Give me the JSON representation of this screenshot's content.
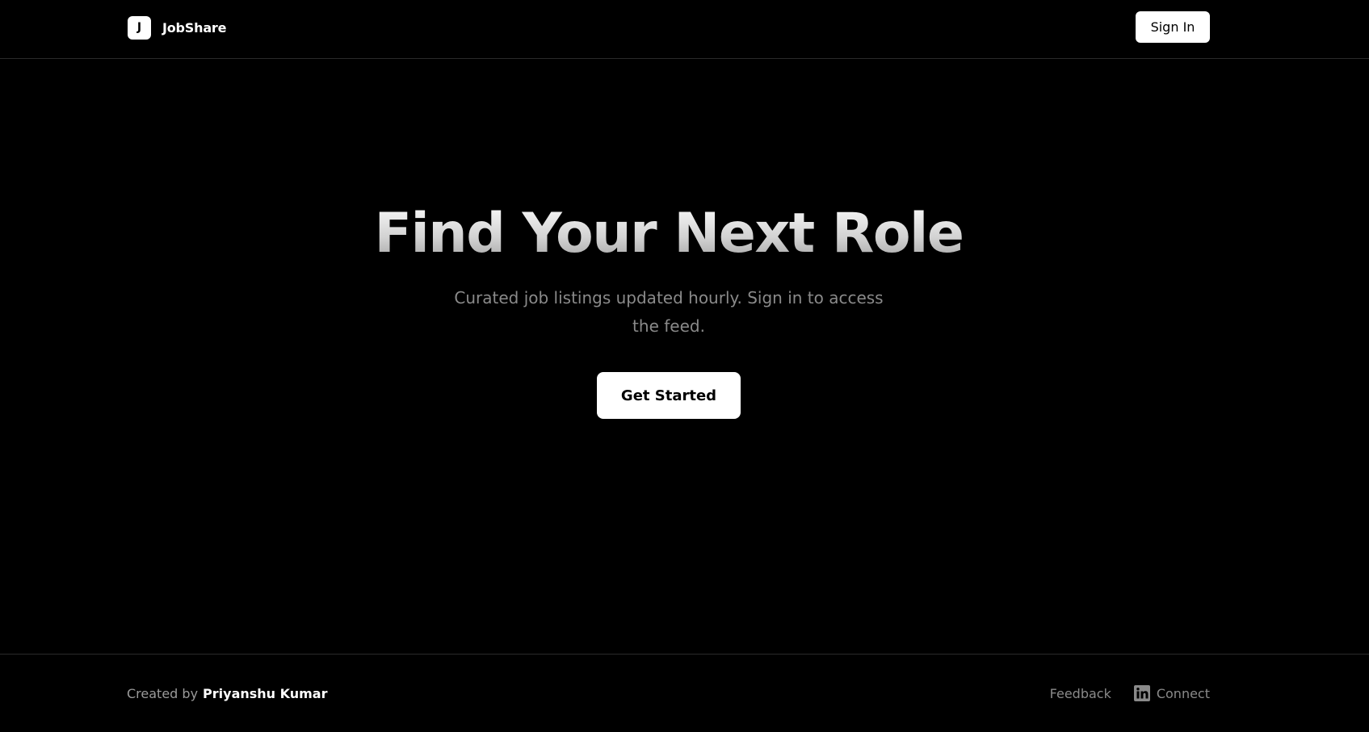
{
  "header": {
    "logo_letter": "J",
    "brand": "JobShare",
    "signin_label": "Sign In"
  },
  "hero": {
    "title": "Find Your Next Role",
    "subtitle": "Curated job listings updated hourly. Sign in to access the feed.",
    "cta_label": "Get Started"
  },
  "footer": {
    "credit_prefix": "Created by",
    "credit_name": "Priyanshu Kumar",
    "feedback_label": "Feedback",
    "connect_label": "Connect",
    "connect_icon": "linkedin-icon"
  },
  "colors": {
    "background": "#000000",
    "button_bg": "#ffffff",
    "muted_text": "#8a8a8a",
    "divider": "#2a2a2a"
  }
}
